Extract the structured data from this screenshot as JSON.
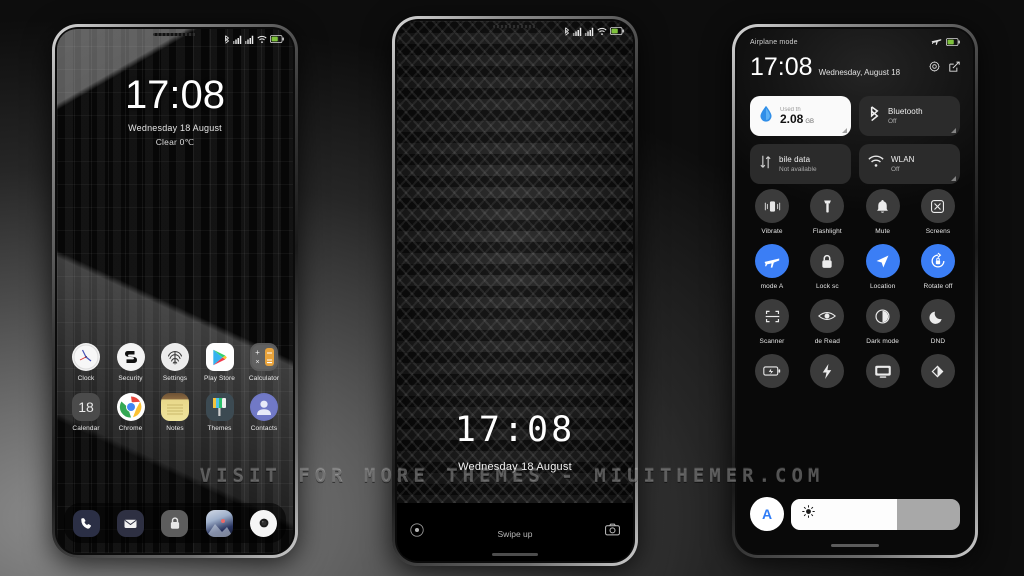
{
  "watermark": "VISIT FOR MORE THEMES - MIUITHEMER.COM",
  "status_bar": {
    "icons": [
      "bluetooth-icon",
      "signal-1-icon",
      "signal-2-icon",
      "wifi-icon",
      "battery-icon"
    ]
  },
  "phone1": {
    "name": "home-screen",
    "clock": {
      "time": "17:08",
      "date": "Wednesday 18 August",
      "weather": "Clear  0℃"
    },
    "apps_row1": [
      {
        "label": "Clock",
        "icon": "clock-icon"
      },
      {
        "label": "Security",
        "icon": "security-icon"
      },
      {
        "label": "Settings",
        "icon": "fingerprint-settings-icon"
      },
      {
        "label": "Play Store",
        "icon": "play-store-icon"
      },
      {
        "label": "Calculator",
        "icon": "calculator-icon"
      }
    ],
    "apps_row2": [
      {
        "label": "Calendar",
        "icon": "calendar-icon",
        "day": "18"
      },
      {
        "label": "Chrome",
        "icon": "chrome-icon"
      },
      {
        "label": "Notes",
        "icon": "notes-icon"
      },
      {
        "label": "Themes",
        "icon": "themes-icon"
      },
      {
        "label": "Contacts",
        "icon": "contacts-icon"
      }
    ],
    "dock": [
      {
        "label": "Phone",
        "icon": "phone-icon"
      },
      {
        "label": "Messaging",
        "icon": "envelope-icon"
      },
      {
        "label": "App Lock",
        "icon": "lock-icon"
      },
      {
        "label": "Gallery",
        "icon": "gallery-icon"
      },
      {
        "label": "Camera",
        "icon": "camera-icon"
      }
    ]
  },
  "phone2": {
    "name": "lock-screen",
    "time": "17:08",
    "date": "Wednesday 18 August",
    "swipe_hint": "Swipe up",
    "left_shortcut": "flashlight-icon",
    "right_shortcut": "camera-icon"
  },
  "phone3": {
    "name": "control-center",
    "airplane_label": "Airplane mode",
    "time": "17:08",
    "date": "Wednesday, August 18",
    "actions": [
      "gear-icon",
      "edit-icon"
    ],
    "big_tiles": [
      {
        "name": "data-usage-tile",
        "title": "2.08",
        "unit": "GB",
        "sub": "Used th",
        "state": "on",
        "icon": "water-drop-icon"
      },
      {
        "name": "bluetooth-tile",
        "title": "Bluetooth",
        "sub": "Off",
        "state": "off",
        "icon": "bluetooth-icon"
      },
      {
        "name": "mobile-data-tile",
        "title": "bile data",
        "sub": "Not available",
        "state": "off",
        "icon": "data-transfer-icon"
      },
      {
        "name": "wlan-tile",
        "title": "WLAN",
        "sub": "Off",
        "state": "off",
        "icon": "wifi-icon"
      }
    ],
    "toggle_rows": [
      [
        {
          "label": "Vibrate",
          "icon": "vibrate-icon",
          "active": false
        },
        {
          "label": "Flashlight",
          "icon": "flashlight-icon",
          "active": false
        },
        {
          "label": "Mute",
          "icon": "bell-icon",
          "active": false
        },
        {
          "label": "Screens",
          "icon": "screenshot-icon",
          "active": false
        }
      ],
      [
        {
          "label": "mode   A",
          "icon": "airplane-icon",
          "active": true
        },
        {
          "label": "Lock sc",
          "icon": "lock-icon",
          "active": false
        },
        {
          "label": "Location",
          "icon": "location-arrow-icon",
          "active": true
        },
        {
          "label": "Rotate off",
          "icon": "rotate-lock-icon",
          "active": true
        }
      ],
      [
        {
          "label": "Scanner",
          "icon": "scan-icon",
          "active": false
        },
        {
          "label": "de   Read",
          "icon": "eye-icon",
          "active": false
        },
        {
          "label": "Dark mode",
          "icon": "contrast-icon",
          "active": false
        },
        {
          "label": "DND",
          "icon": "moon-icon",
          "active": false
        }
      ],
      [
        {
          "label": "",
          "icon": "battery-saver-icon",
          "active": false
        },
        {
          "label": "",
          "icon": "lightning-icon",
          "active": false
        },
        {
          "label": "",
          "icon": "cast-screen-icon",
          "active": false
        },
        {
          "label": "",
          "icon": "reading-contrast-icon",
          "active": false
        }
      ]
    ],
    "brightness": {
      "auto_label": "A",
      "icon": "sun-icon",
      "fill_percent": 63
    }
  }
}
